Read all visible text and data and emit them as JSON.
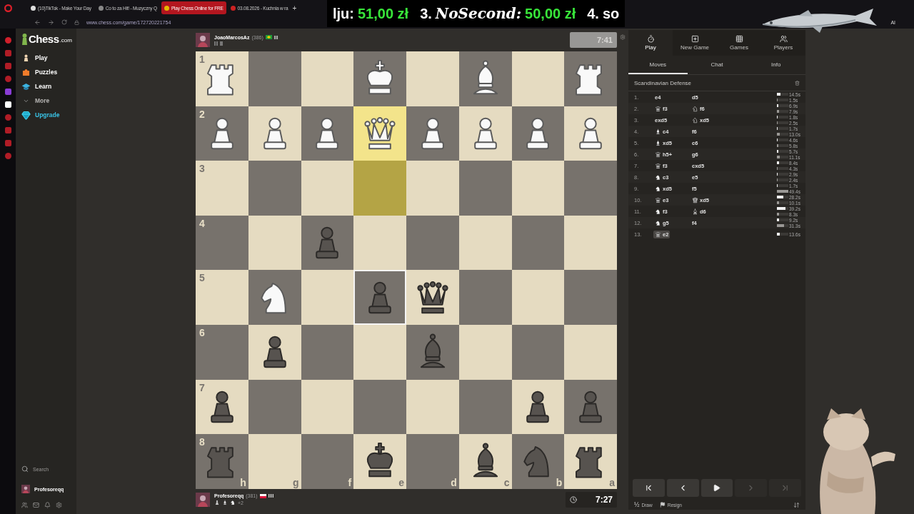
{
  "browser": {
    "tabs": [
      {
        "title": "(10)TikTok - Make Your Day",
        "selected": false
      },
      {
        "title": "Co to za Hit! - Muzyczny Q",
        "selected": false
      },
      {
        "title": "Play Chess Online for FRE",
        "selected": true
      },
      {
        "title": "03.08.2026 - Kuchnia w ra",
        "selected": false
      }
    ],
    "new_tab": "+",
    "url": "www.chess.com/game/172720221754",
    "extension_label": "AI"
  },
  "ticker": [
    {
      "name": "lju:",
      "amount": "51,00 zł"
    },
    {
      "place": "3.",
      "name": "NoSecond:",
      "amount": "50,00 zł"
    },
    {
      "place": "4.",
      "name": "so"
    }
  ],
  "nav": {
    "logo": {
      "name": "Chess",
      "suffix": ".com"
    },
    "items": [
      {
        "label": "Play",
        "kind": "play"
      },
      {
        "label": "Puzzles",
        "kind": "puzzles"
      },
      {
        "label": "Learn",
        "kind": "learn"
      },
      {
        "label": "More",
        "kind": "more"
      },
      {
        "label": "Upgrade",
        "kind": "upgrade"
      }
    ],
    "search": "Search",
    "user": "Profesoreqq"
  },
  "top_player": {
    "name": "JoaoMarcosAz",
    "rating": "(386)",
    "clock": {
      "time": "7:41",
      "active": false
    }
  },
  "bottom_player": {
    "name": "Profesoreqq",
    "rating": "(381)",
    "captured": [
      {
        "kind": "pawn"
      },
      {
        "kind": "bishop"
      },
      {
        "kind": "knight"
      }
    ],
    "advantage": "+2",
    "clock": {
      "time": "7:27",
      "active": true
    }
  },
  "board": {
    "files": [
      "h",
      "g",
      "f",
      "e",
      "d",
      "c",
      "b",
      "a"
    ],
    "ranks": [
      {
        "label": "1",
        "squares": [
          {
            "kind": "white-rook",
            "highlighted": false,
            "hovered": false
          },
          {
            "kind": "empty",
            "highlighted": false,
            "hovered": false
          },
          {
            "kind": "empty",
            "highlighted": false,
            "hovered": false
          },
          {
            "kind": "white-king",
            "highlighted": false,
            "hovered": false
          },
          {
            "kind": "empty",
            "highlighted": false,
            "hovered": false
          },
          {
            "kind": "white-bishop",
            "highlighted": false,
            "hovered": false
          },
          {
            "kind": "empty",
            "highlighted": false,
            "hovered": false
          },
          {
            "kind": "white-rook",
            "highlighted": false,
            "hovered": false
          }
        ]
      },
      {
        "label": "2",
        "squares": [
          {
            "kind": "white-pawn",
            "highlighted": false,
            "hovered": false
          },
          {
            "kind": "white-pawn",
            "highlighted": false,
            "hovered": false
          },
          {
            "kind": "white-pawn",
            "highlighted": false,
            "hovered": false
          },
          {
            "kind": "white-queen",
            "highlighted": true,
            "hovered": false
          },
          {
            "kind": "white-pawn",
            "highlighted": false,
            "hovered": false
          },
          {
            "kind": "white-pawn",
            "highlighted": false,
            "hovered": false
          },
          {
            "kind": "white-pawn",
            "highlighted": false,
            "hovered": false
          },
          {
            "kind": "white-pawn",
            "highlighted": false,
            "hovered": false
          }
        ]
      },
      {
        "label": "3",
        "squares": [
          {
            "kind": "empty",
            "highlighted": false,
            "hovered": false
          },
          {
            "kind": "empty",
            "highlighted": false,
            "hovered": false
          },
          {
            "kind": "empty",
            "highlighted": false,
            "hovered": false
          },
          {
            "kind": "empty",
            "highlighted": true,
            "hovered": false
          },
          {
            "kind": "empty",
            "highlighted": false,
            "hovered": false
          },
          {
            "kind": "empty",
            "highlighted": false,
            "hovered": false
          },
          {
            "kind": "empty",
            "highlighted": false,
            "hovered": false
          },
          {
            "kind": "empty",
            "highlighted": false,
            "hovered": false
          }
        ]
      },
      {
        "label": "4",
        "squares": [
          {
            "kind": "empty",
            "highlighted": false,
            "hovered": false
          },
          {
            "kind": "empty",
            "highlighted": false,
            "hovered": false
          },
          {
            "kind": "black-pawn",
            "highlighted": false,
            "hovered": false
          },
          {
            "kind": "empty",
            "highlighted": false,
            "hovered": false
          },
          {
            "kind": "empty",
            "highlighted": false,
            "hovered": false
          },
          {
            "kind": "empty",
            "highlighted": false,
            "hovered": false
          },
          {
            "kind": "empty",
            "highlighted": false,
            "hovered": false
          },
          {
            "kind": "empty",
            "highlighted": false,
            "hovered": false
          }
        ]
      },
      {
        "label": "5",
        "squares": [
          {
            "kind": "empty",
            "highlighted": false,
            "hovered": false
          },
          {
            "kind": "white-knight",
            "highlighted": false,
            "hovered": false
          },
          {
            "kind": "empty",
            "highlighted": false,
            "hovered": false
          },
          {
            "kind": "black-pawn",
            "highlighted": false,
            "hovered": true
          },
          {
            "kind": "black-queen",
            "highlighted": false,
            "hovered": false
          },
          {
            "kind": "empty",
            "highlighted": false,
            "hovered": false
          },
          {
            "kind": "empty",
            "highlighted": false,
            "hovered": false
          },
          {
            "kind": "empty",
            "highlighted": false,
            "hovered": false
          }
        ]
      },
      {
        "label": "6",
        "squares": [
          {
            "kind": "empty",
            "highlighted": false,
            "hovered": false
          },
          {
            "kind": "black-pawn",
            "highlighted": false,
            "hovered": false
          },
          {
            "kind": "empty",
            "highlighted": false,
            "hovered": false
          },
          {
            "kind": "empty",
            "highlighted": false,
            "hovered": false
          },
          {
            "kind": "black-bishop",
            "highlighted": false,
            "hovered": false
          },
          {
            "kind": "empty",
            "highlighted": false,
            "hovered": false
          },
          {
            "kind": "empty",
            "highlighted": false,
            "hovered": false
          },
          {
            "kind": "empty",
            "highlighted": false,
            "hovered": false
          }
        ]
      },
      {
        "label": "7",
        "squares": [
          {
            "kind": "black-pawn",
            "highlighted": false,
            "hovered": false
          },
          {
            "kind": "empty",
            "highlighted": false,
            "hovered": false
          },
          {
            "kind": "empty",
            "highlighted": false,
            "hovered": false
          },
          {
            "kind": "empty",
            "highlighted": false,
            "hovered": false
          },
          {
            "kind": "empty",
            "highlighted": false,
            "hovered": false
          },
          {
            "kind": "empty",
            "highlighted": false,
            "hovered": false
          },
          {
            "kind": "black-pawn",
            "highlighted": false,
            "hovered": false
          },
          {
            "kind": "black-pawn",
            "highlighted": false,
            "hovered": false
          }
        ]
      },
      {
        "label": "8",
        "squares": [
          {
            "kind": "black-rook",
            "highlighted": false,
            "hovered": false
          },
          {
            "kind": "empty",
            "highlighted": false,
            "hovered": false
          },
          {
            "kind": "empty",
            "highlighted": false,
            "hovered": false
          },
          {
            "kind": "black-king",
            "highlighted": false,
            "hovered": false
          },
          {
            "kind": "empty",
            "highlighted": false,
            "hovered": false
          },
          {
            "kind": "black-bishop",
            "highlighted": false,
            "hovered": false
          },
          {
            "kind": "black-knight",
            "highlighted": false,
            "hovered": false
          },
          {
            "kind": "black-rook",
            "highlighted": false,
            "hovered": false
          }
        ]
      }
    ]
  },
  "panel": {
    "nav": [
      {
        "label": "Play",
        "kind": "play",
        "selected": true
      },
      {
        "label": "New Game",
        "kind": "new-game",
        "selected": false
      },
      {
        "label": "Games",
        "kind": "games",
        "selected": false
      },
      {
        "label": "Players",
        "kind": "players",
        "selected": false
      }
    ],
    "tabs": [
      {
        "label": "Moves",
        "selected": true
      },
      {
        "label": "Chat",
        "selected": false
      },
      {
        "label": "Info",
        "selected": false
      }
    ],
    "opening": "Scandinavian Defense",
    "moves": [
      {
        "number": "1.",
        "white": {
          "kind": "pawn",
          "san": "e4",
          "time": "14.5s",
          "level": 0.29,
          "selected": false
        },
        "black": {
          "kind": "pawn",
          "san": "d5",
          "time": "1.5s",
          "level": 0.03,
          "selected": false
        }
      },
      {
        "number": "2.",
        "white": {
          "kind": "queen",
          "san": "f3",
          "time": "6.9s",
          "level": 0.14,
          "selected": false
        },
        "black": {
          "kind": "knight",
          "san": "f6",
          "time": "7.9s",
          "level": 0.16,
          "selected": false
        }
      },
      {
        "number": "3.",
        "white": {
          "kind": "pawn",
          "san": "exd5",
          "time": "1.8s",
          "level": 0.04,
          "selected": false
        },
        "black": {
          "kind": "knight",
          "san": "xd5",
          "time": "2.5s",
          "level": 0.05,
          "selected": false
        }
      },
      {
        "number": "4.",
        "white": {
          "kind": "bishop",
          "san": "c4",
          "time": "1.7s",
          "level": 0.03,
          "selected": false
        },
        "black": {
          "kind": "pawn",
          "san": "f6",
          "time": "13.0s",
          "level": 0.26,
          "selected": false
        }
      },
      {
        "number": "5.",
        "white": {
          "kind": "bishop",
          "san": "xd5",
          "time": "4.6s",
          "level": 0.09,
          "selected": false
        },
        "black": {
          "kind": "pawn",
          "san": "c6",
          "time": "5.8s",
          "level": 0.12,
          "selected": false
        }
      },
      {
        "number": "6.",
        "white": {
          "kind": "queen",
          "san": "h5+",
          "time": "5.7s",
          "level": 0.11,
          "selected": false
        },
        "black": {
          "kind": "pawn",
          "san": "g6",
          "time": "11.1s",
          "level": 0.22,
          "selected": false
        }
      },
      {
        "number": "7.",
        "white": {
          "kind": "queen",
          "san": "f3",
          "time": "8.4s",
          "level": 0.17,
          "selected": false
        },
        "black": {
          "kind": "pawn",
          "san": "cxd5",
          "time": "4.3s",
          "level": 0.09,
          "selected": false
        }
      },
      {
        "number": "8.",
        "white": {
          "kind": "knight",
          "san": "c3",
          "time": "2.9s",
          "level": 0.06,
          "selected": false
        },
        "black": {
          "kind": "pawn",
          "san": "e5",
          "time": "2.4s",
          "level": 0.05,
          "selected": false
        }
      },
      {
        "number": "9.",
        "white": {
          "kind": "knight",
          "san": "xd5",
          "time": "1.7s",
          "level": 0.03,
          "selected": false
        },
        "black": {
          "kind": "pawn",
          "san": "f5",
          "time": "49.4s",
          "level": 0.99,
          "selected": false
        }
      },
      {
        "number": "10.",
        "white": {
          "kind": "queen",
          "san": "e3",
          "time": "28.2s",
          "level": 0.56,
          "selected": false
        },
        "black": {
          "kind": "queen",
          "san": "xd5",
          "time": "10.1s",
          "level": 0.2,
          "selected": false
        }
      },
      {
        "number": "11.",
        "white": {
          "kind": "knight",
          "san": "f3",
          "time": "39.2s",
          "level": 0.78,
          "selected": false
        },
        "black": {
          "kind": "bishop",
          "san": "d6",
          "time": "8.3s",
          "level": 0.17,
          "selected": false
        }
      },
      {
        "number": "12.",
        "white": {
          "kind": "knight",
          "san": "g5",
          "time": "9.2s",
          "level": 0.18,
          "selected": false
        },
        "black": {
          "kind": "pawn",
          "san": "f4",
          "time": "31.3s",
          "level": 0.63,
          "selected": false
        }
      },
      {
        "number": "13.",
        "white": {
          "kind": "queen",
          "san": "e2",
          "time": "13.6s",
          "level": 0.27,
          "selected": true
        }
      }
    ],
    "controls": [
      {
        "kind": "first",
        "disabled": false
      },
      {
        "kind": "previous",
        "disabled": false
      },
      {
        "kind": "play",
        "disabled": false
      },
      {
        "kind": "next",
        "disabled": true
      },
      {
        "kind": "last",
        "disabled": true
      }
    ],
    "draw": {
      "glyph": "½",
      "label": "Draw"
    },
    "resign": "Resign"
  }
}
